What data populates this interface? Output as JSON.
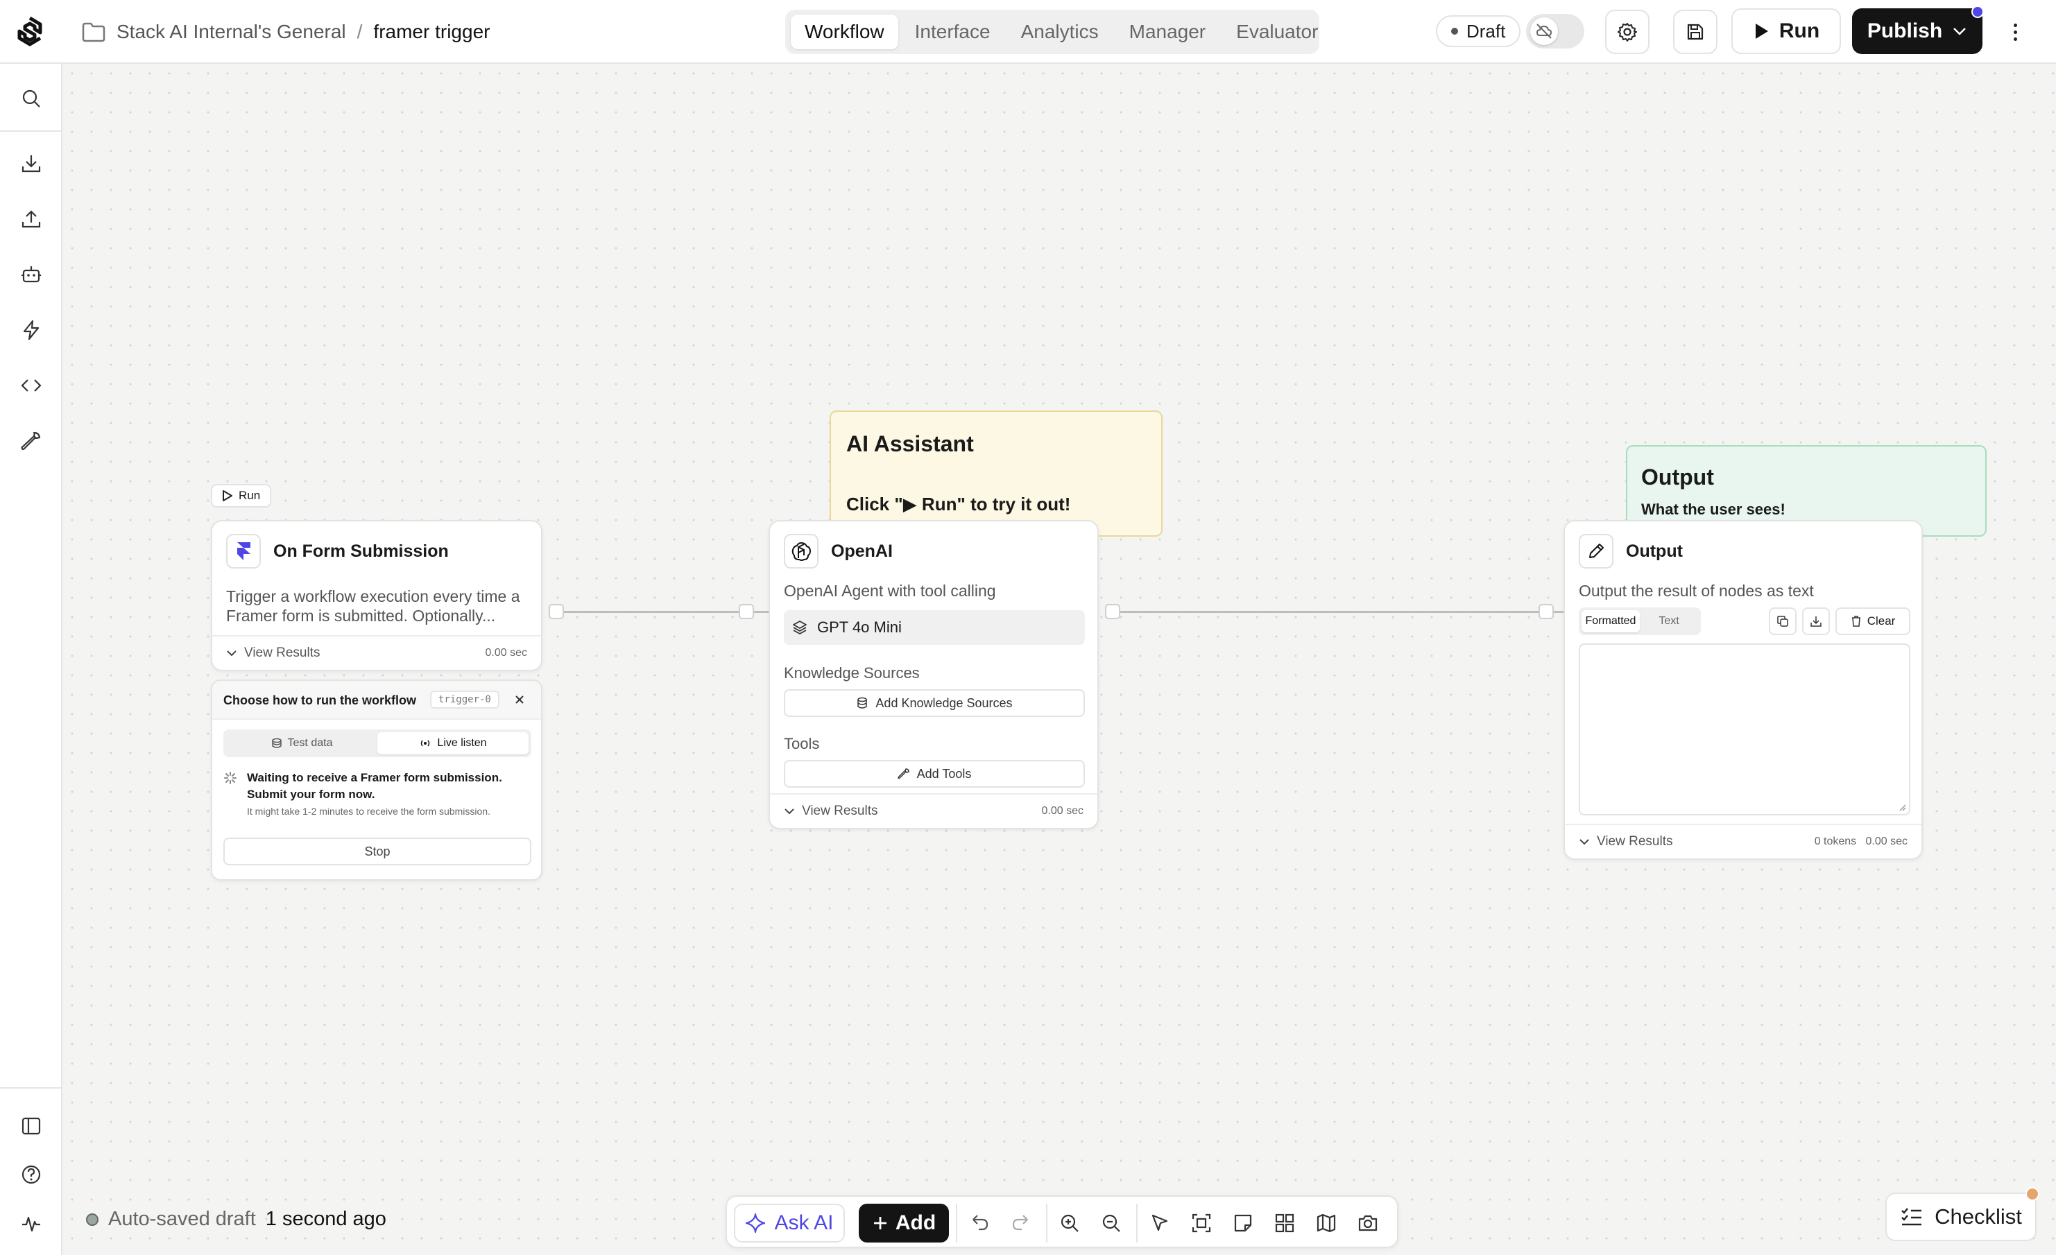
{
  "header": {
    "workspace": "Stack AI Internal's General",
    "separator": "/",
    "project": "framer trigger",
    "tabs": [
      "Workflow",
      "Interface",
      "Analytics",
      "Manager",
      "Evaluator"
    ],
    "active_tab": "Workflow",
    "status": "Draft",
    "run_label": "Run",
    "publish_label": "Publish"
  },
  "canvas": {
    "notes": {
      "assistant": {
        "title": "AI Assistant",
        "body": "Click \"▶ Run\" to try it out!"
      },
      "output": {
        "title": "Output",
        "body": "What the user sees!"
      }
    },
    "mini_run_label": "Run",
    "trigger_node": {
      "title": "On Form Submission",
      "description": "Trigger a workflow execution every time a Framer form is submitted. Optionally...",
      "view_results": "View Results",
      "time": "0.00 sec"
    },
    "trigger_panel": {
      "title": "Choose how to run the workflow",
      "code": "trigger-0",
      "tabs": [
        "Test data",
        "Live listen"
      ],
      "active_tab": "Live listen",
      "waiting": "Waiting to receive a Framer form submission. Submit your form now.",
      "hint": "It might take 1-2 minutes to receive the form submission.",
      "stop_label": "Stop"
    },
    "openai_node": {
      "title": "OpenAI",
      "description": "OpenAI Agent with tool calling",
      "model": "GPT 4o Mini",
      "knowledge_label": "Knowledge Sources",
      "add_knowledge": "Add Knowledge Sources",
      "tools_label": "Tools",
      "add_tools": "Add Tools",
      "view_results": "View Results",
      "time": "0.00 sec"
    },
    "output_node": {
      "title": "Output",
      "description": "Output the result of nodes as text",
      "tabs": [
        "Formatted",
        "Text"
      ],
      "active_tab": "Formatted",
      "clear_label": "Clear",
      "view_results": "View Results",
      "tokens": "0 tokens",
      "time": "0.00 sec"
    }
  },
  "footer": {
    "autosave_prefix": "Auto-saved draft",
    "autosave_time": "1 second ago",
    "ask_ai_label": "Ask AI",
    "add_label": "Add",
    "checklist_label": "Checklist"
  },
  "colors": {
    "accent": "#4f46e5",
    "primary_button": "#141414",
    "note_yellow": "#fdf8e4",
    "note_green": "#e9f6ef",
    "notification": "#e6a56b"
  },
  "icons": {
    "sidebar": [
      "search-icon",
      "download-icon",
      "upload-icon",
      "bot-icon",
      "zap-icon",
      "code-icon",
      "wrench-icon",
      "sidebar-toggle-icon",
      "help-icon",
      "activity-icon"
    ],
    "toolbar": [
      "undo-icon",
      "redo-icon",
      "zoom-in-icon",
      "zoom-out-icon",
      "pointer-icon",
      "fit-view-icon",
      "note-icon",
      "layout-icon",
      "map-icon",
      "camera-icon"
    ]
  }
}
